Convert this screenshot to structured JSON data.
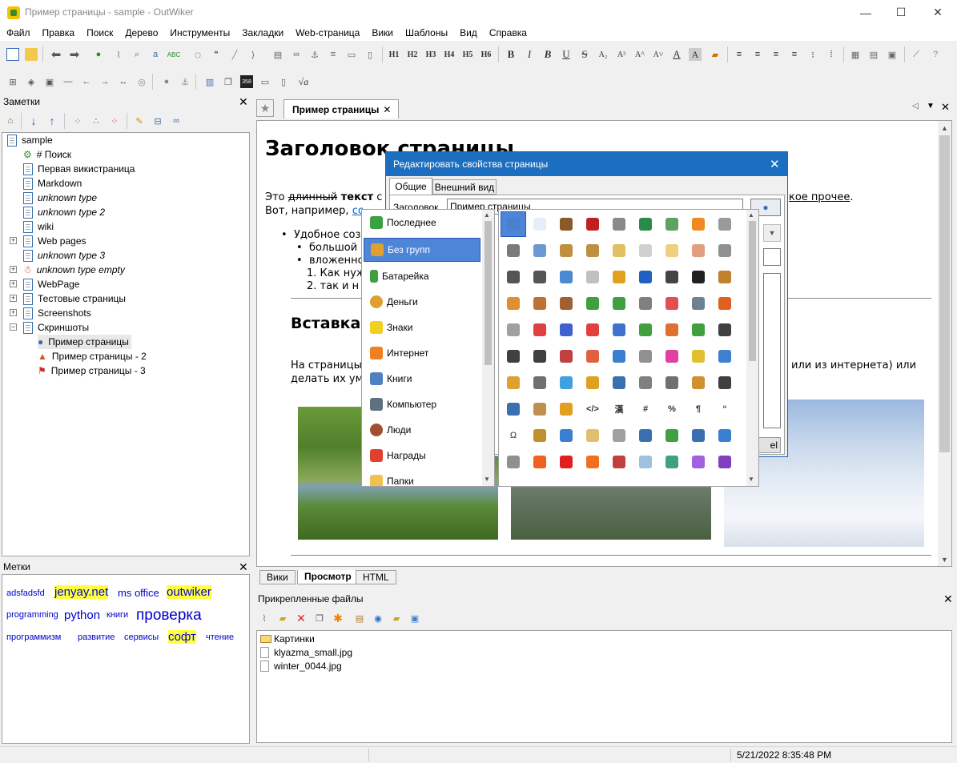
{
  "window": {
    "title": "Пример страницы - sample - OutWiker",
    "minimize": "—",
    "maximize": "☐",
    "close": "✕"
  },
  "menu": [
    "Файл",
    "Правка",
    "Поиск",
    "Дерево",
    "Инструменты",
    "Закладки",
    "Web-страница",
    "Вики",
    "Шаблоны",
    "Вид",
    "Справка"
  ],
  "toolbar": {
    "headings": [
      "H1",
      "H2",
      "H3",
      "H4",
      "H5",
      "H6"
    ],
    "format": [
      "B",
      "I",
      "B",
      "U",
      "S",
      "A₂",
      "A²",
      "A^",
      "A˅",
      "A",
      "A"
    ],
    "formula": "√a"
  },
  "notes_panel": {
    "title": "Заметки",
    "tree": [
      {
        "label": "sample",
        "level": 0,
        "italic": false
      },
      {
        "label": "# Поиск",
        "level": 1,
        "italic": false
      },
      {
        "label": "Первая викистраница",
        "level": 1,
        "italic": false
      },
      {
        "label": "Markdown",
        "level": 1,
        "italic": false
      },
      {
        "label": "unknown type",
        "level": 1,
        "italic": true
      },
      {
        "label": "unknown type 2",
        "level": 1,
        "italic": true
      },
      {
        "label": "wiki",
        "level": 1,
        "italic": false
      },
      {
        "label": "Web pages",
        "level": 1,
        "italic": false
      },
      {
        "label": "unknown type 3",
        "level": 1,
        "italic": true
      },
      {
        "label": "unknown type empty",
        "level": 1,
        "italic": true
      },
      {
        "label": "WebPage",
        "level": 1,
        "italic": false
      },
      {
        "label": "Тестовые страницы",
        "level": 1,
        "italic": false
      },
      {
        "label": "Screenshots",
        "level": 1,
        "italic": false
      },
      {
        "label": "Скриншоты",
        "level": 1,
        "italic": false
      },
      {
        "label": "Пример страницы",
        "level": 2,
        "italic": false
      },
      {
        "label": "Пример страницы - 2",
        "level": 2,
        "italic": false
      },
      {
        "label": "Пример страницы - 3",
        "level": 2,
        "italic": false
      }
    ]
  },
  "tags_panel": {
    "title": "Метки",
    "tags": [
      {
        "label": "adsfadsfd",
        "size": "small",
        "highlight": false
      },
      {
        "label": "jenyay.net",
        "size": "large",
        "highlight": true
      },
      {
        "label": "ms office",
        "size": "medium",
        "highlight": false
      },
      {
        "label": "outwiker",
        "size": "large",
        "highlight": true
      },
      {
        "label": "programming",
        "size": "small",
        "highlight": false
      },
      {
        "label": "python",
        "size": "large",
        "highlight": false
      },
      {
        "label": "книги",
        "size": "small",
        "highlight": false
      },
      {
        "label": "проверка",
        "size": "xlarge",
        "highlight": false
      },
      {
        "label": "программизм",
        "size": "small",
        "highlight": false
      },
      {
        "label": "развитие",
        "size": "small",
        "highlight": false
      },
      {
        "label": "сервисы",
        "size": "small",
        "highlight": false
      },
      {
        "label": "софт",
        "size": "large",
        "highlight": true
      },
      {
        "label": "чтение",
        "size": "small",
        "highlight": false
      }
    ]
  },
  "editor": {
    "tab_label": "Пример страницы",
    "tab_close": "✕",
    "heading": "Заголовок страницы",
    "line1_a": "Это ",
    "line1_b": "длинный",
    "line1_c": " текст",
    "line1_d": " с",
    "line1_tail": "кое прочее",
    "line1_tail2": ".",
    "line2": "Вот, например, ",
    "line2_link": "сс",
    "bullet1": "Удобное соз",
    "bullet1_1": "большой",
    "bullet1_2": "вложенно",
    "num1": "1.  Как нуж",
    "num2": "2.  так и н",
    "heading2": "Вставка",
    "para_a": "На страницы",
    "para_b": "делать их ум",
    "para_tail": "или из интернета) или",
    "bottom_tabs": [
      "Вики",
      "Просмотр",
      "HTML"
    ]
  },
  "attachments": {
    "title": "Прикрепленные файлы",
    "files": [
      "Картинки",
      "klyazma_small.jpg",
      "winter_0044.jpg"
    ]
  },
  "status": {
    "datetime": "5/21/2022 8:35:48 PM"
  },
  "dialog": {
    "title": "Редактировать свойства страницы",
    "tabs": [
      "Общие",
      "Внешний вид"
    ],
    "field_label": "Заголовок",
    "field_value": "Пример страницы",
    "cancel_partial": "el"
  },
  "icon_popup": {
    "categories": [
      "Последнее",
      "Без групп",
      "Батарейка",
      "Деньги",
      "Знаки",
      "Интернет",
      "Книги",
      "Компьютер",
      "Люди",
      "Награды",
      "Папки"
    ],
    "selected_category": "Без групп",
    "glyph_row": [
      "</>",
      "漢",
      "#",
      "%",
      "¶",
      "“"
    ],
    "omega": "Ω"
  },
  "colors": {
    "accent": "#1c6fc0",
    "selection": "#4d86d9",
    "tag_highlight": "#ffff40",
    "link": "#0000cc"
  }
}
